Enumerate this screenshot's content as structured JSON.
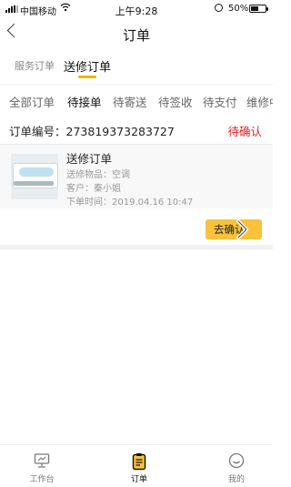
{
  "status_bar": {
    "carrier": "中国移动",
    "time": "上午9:28",
    "battery_percent": "50%",
    "battery_level": 0.5
  },
  "header": {
    "title": "订单"
  },
  "order_type_tabs": [
    {
      "label": "服务订单",
      "active": false
    },
    {
      "label": "送修订单",
      "active": true
    }
  ],
  "status_tabs": [
    {
      "label": "全部订单",
      "active": false
    },
    {
      "label": "待接单",
      "active": true
    },
    {
      "label": "待寄送",
      "active": false
    },
    {
      "label": "待签收",
      "active": false
    },
    {
      "label": "待支付",
      "active": false
    },
    {
      "label": "维修中",
      "active": false
    }
  ],
  "order": {
    "number_label": "订单编号：",
    "number": "273819373283727",
    "status": "待确认",
    "title": "送修订单",
    "item_line": "送修物品：空调",
    "customer_line": "客户：秦小姐",
    "time_line": "下单时间：2019.04.16  10:47",
    "confirm_label": "去确认"
  },
  "bottom_nav": [
    {
      "label": "工作台",
      "icon": "monitor-icon",
      "active": false
    },
    {
      "label": "订单",
      "icon": "clipboard-icon",
      "active": true
    },
    {
      "label": "我的",
      "icon": "smiley-icon",
      "active": false
    }
  ],
  "colors": {
    "accent": "#f5b400",
    "button": "#f8c23a",
    "status_red": "#e02020"
  }
}
